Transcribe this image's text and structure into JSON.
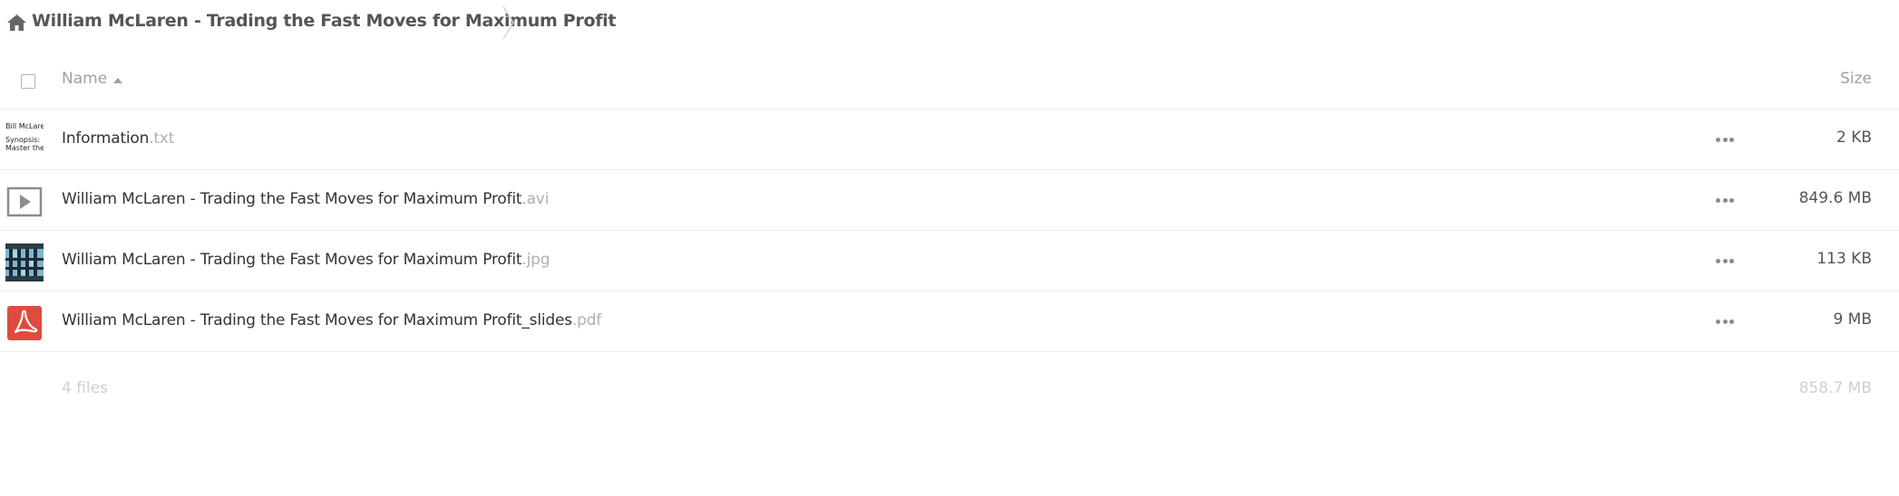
{
  "breadcrumb": {
    "folder": "William McLaren - Trading the Fast Moves for Maximum Profit"
  },
  "table": {
    "name_header": "Name",
    "size_header": "Size",
    "sort": "ascending"
  },
  "files": [
    {
      "base": "Information",
      "ext": ".txt",
      "size": "2 KB",
      "thumb": "text-preview",
      "preview_lines": [
        "Bill McLaren",
        "Synopsis:",
        "Master the"
      ]
    },
    {
      "base": "William McLaren - Trading the Fast Moves for Maximum Profit",
      "ext": ".avi",
      "size": "849.6 MB",
      "thumb": "video-play-icon"
    },
    {
      "base": "William McLaren - Trading the Fast Moves for Maximum Profit",
      "ext": ".jpg",
      "size": "113 KB",
      "thumb": "image-thumbnail"
    },
    {
      "base": "William McLaren - Trading the Fast Moves for Maximum Profit_slides",
      "ext": ".pdf",
      "size": "9 MB",
      "thumb": "pdf-icon"
    }
  ],
  "summary": {
    "count": "4 files",
    "total_size": "858.7 MB"
  },
  "colors": {
    "pdf_red": "#e04b3f",
    "muted_text": "#a0a0a0",
    "row_border": "#ececec"
  }
}
